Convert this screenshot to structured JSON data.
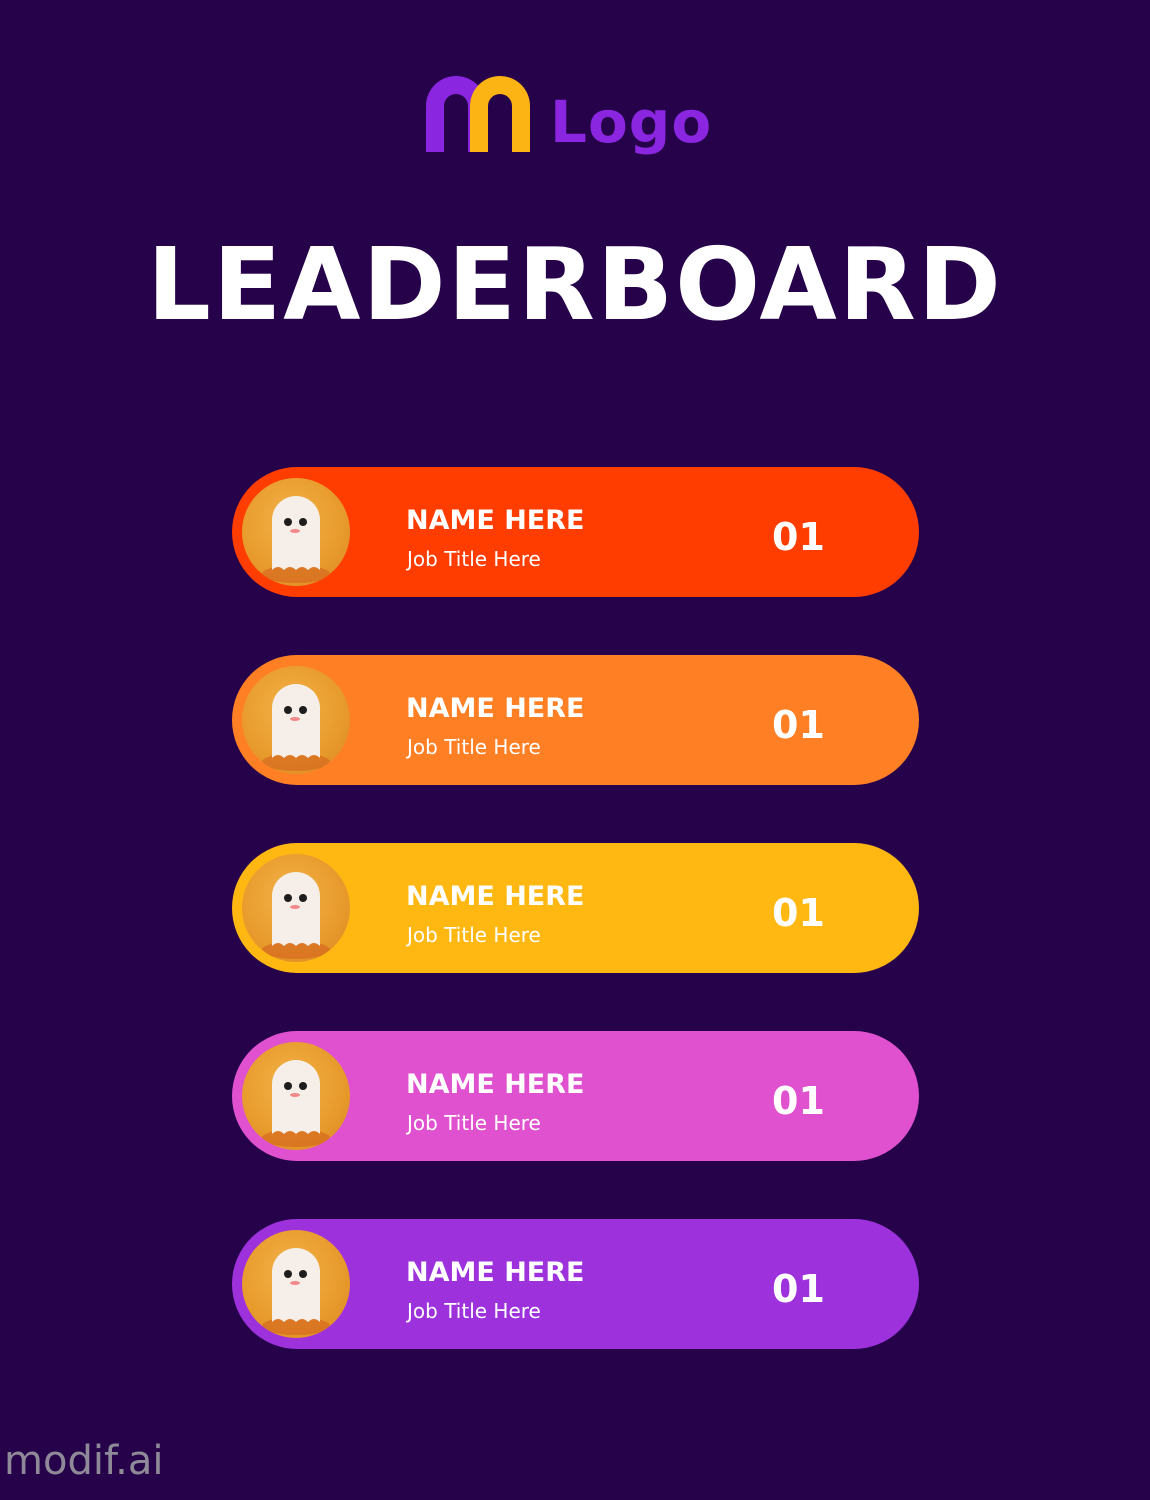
{
  "brand": {
    "logo_text": "Logo",
    "logo_colors": {
      "arch_back": "#8a25e0",
      "arch_front": "#fcb314",
      "text": "#8a25e0"
    }
  },
  "page": {
    "title": "LEADERBOARD",
    "background": "#26024a"
  },
  "entries": [
    {
      "name": "NAME HERE",
      "job_title": "Job Title Here",
      "score": "01",
      "color": "#ff3d00",
      "avatar_icon": "ghost-icon"
    },
    {
      "name": "NAME HERE",
      "job_title": "Job Title Here",
      "score": "01",
      "color": "#ff7f24",
      "avatar_icon": "ghost-icon"
    },
    {
      "name": "NAME HERE",
      "job_title": "Job Title Here",
      "score": "01",
      "color": "#ffb712",
      "avatar_icon": "ghost-icon"
    },
    {
      "name": "NAME HERE",
      "job_title": "Job Title Here",
      "score": "01",
      "color": "#df51cf",
      "avatar_icon": "ghost-icon"
    },
    {
      "name": "NAME HERE",
      "job_title": "Job Title Here",
      "score": "01",
      "color": "#9d32dd",
      "avatar_icon": "ghost-icon"
    }
  ],
  "watermark": "modif.ai"
}
